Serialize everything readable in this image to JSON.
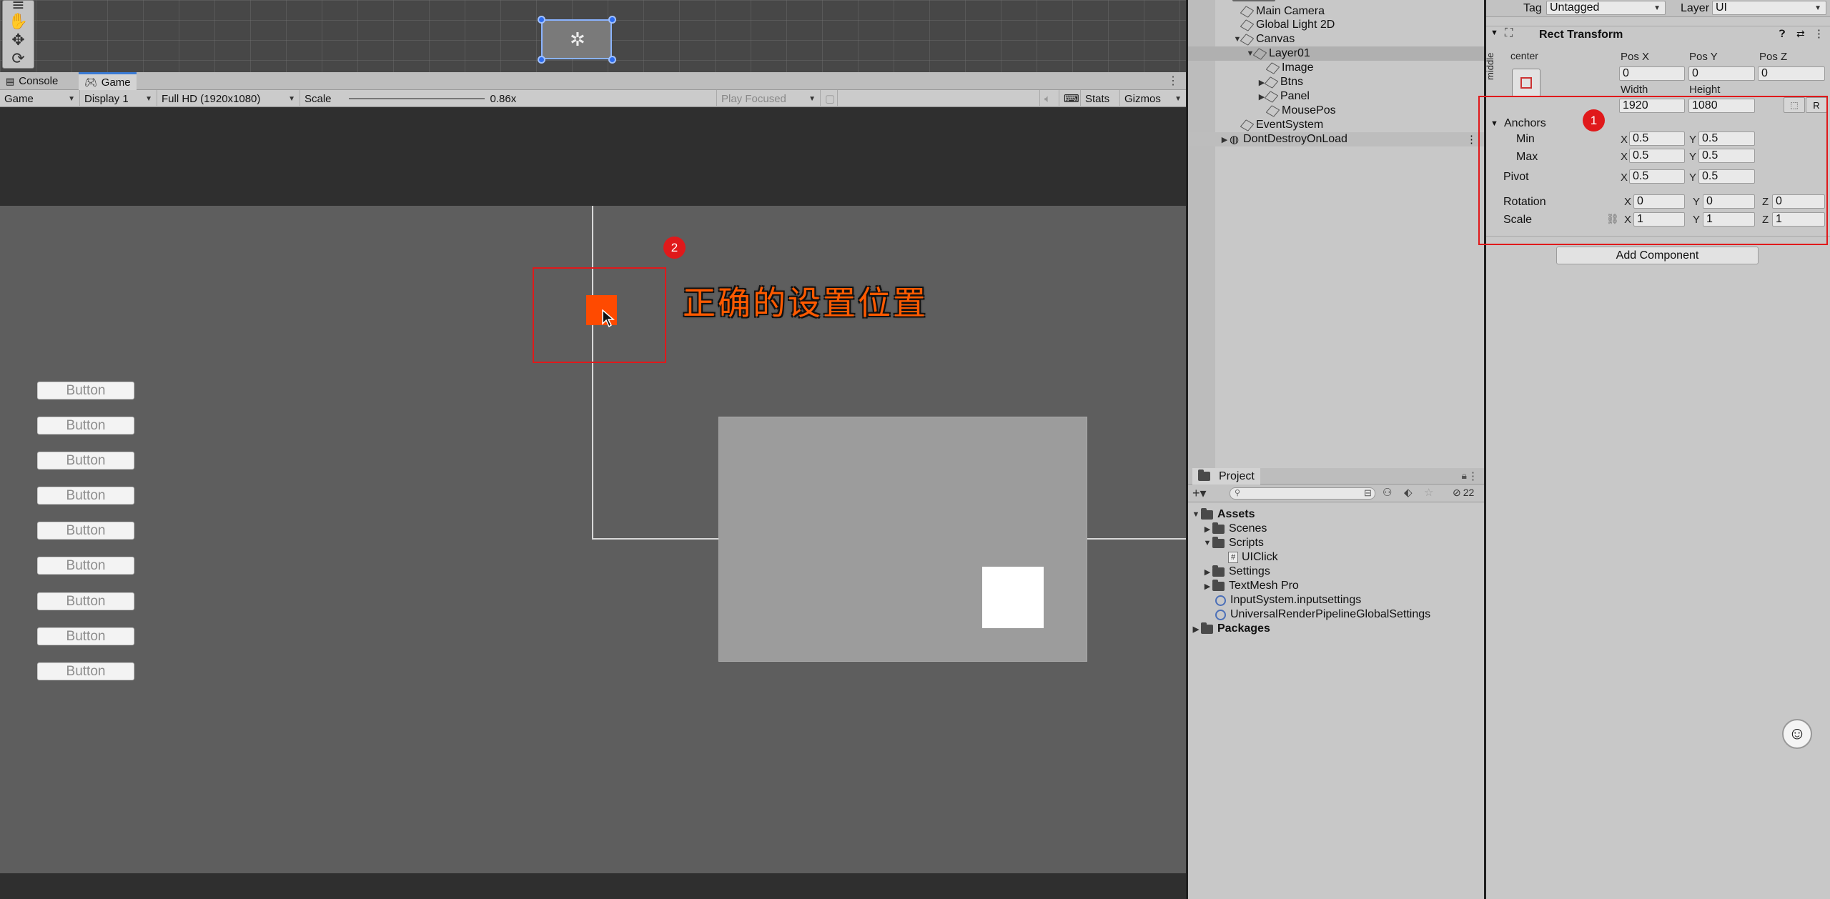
{
  "game_tabs": {
    "console": "Console",
    "game": "Game"
  },
  "game_toolbar": {
    "view": "Game",
    "display": "Display 1",
    "resolution": "Full HD (1920x1080)",
    "scale_label": "Scale",
    "scale_value": "0.86x",
    "play_focused": "Play Focused",
    "stats": "Stats",
    "gizmos": "Gizmos"
  },
  "game_buttons": [
    "Button",
    "Button",
    "Button",
    "Button",
    "Button",
    "Button",
    "Button",
    "Button",
    "Button"
  ],
  "annotation": {
    "callout_text": "正确的设置位置",
    "badge_1": "1",
    "badge_2": "2",
    "color": "#e0191b"
  },
  "hierarchy": {
    "items": [
      "Main Camera",
      "Global Light 2D",
      "Canvas",
      "Layer01",
      "Image",
      "Btns",
      "Panel",
      "MousePos",
      "EventSystem",
      "DontDestroyOnLoad"
    ]
  },
  "project": {
    "title": "Project",
    "badge_count": "22",
    "items": [
      "Assets",
      "Scenes",
      "Scripts",
      "UIClick",
      "Settings",
      "TextMesh Pro",
      "InputSystem.inputsettings",
      "UniversalRenderPipelineGlobalSettings",
      "Packages"
    ]
  },
  "inspector": {
    "tag_label": "Tag",
    "tag_value": "Untagged",
    "layer_label": "Layer",
    "layer_value": "UI",
    "component_title": "Rect Transform",
    "anchor_preset_top": "center",
    "anchor_preset_side": "middle",
    "pos_x_label": "Pos X",
    "pos_y_label": "Pos Y",
    "pos_z_label": "Pos Z",
    "pos_x": "0",
    "pos_y": "0",
    "pos_z": "0",
    "width_label": "Width",
    "height_label": "Height",
    "width": "1920",
    "height": "1080",
    "r_button": "R",
    "anchors_label": "Anchors",
    "min_label": "Min",
    "max_label": "Max",
    "min_x": "0.5",
    "min_y": "0.5",
    "max_x": "0.5",
    "max_y": "0.5",
    "pivot_label": "Pivot",
    "pivot_x": "0.5",
    "pivot_y": "0.5",
    "rotation_label": "Rotation",
    "rot_x": "0",
    "rot_y": "0",
    "rot_z": "0",
    "scale_label": "Scale",
    "scale_x": "1",
    "scale_y": "1",
    "scale_z": "1",
    "axis_x": "X",
    "axis_y": "Y",
    "axis_z": "Z",
    "add_component": "Add Component"
  }
}
